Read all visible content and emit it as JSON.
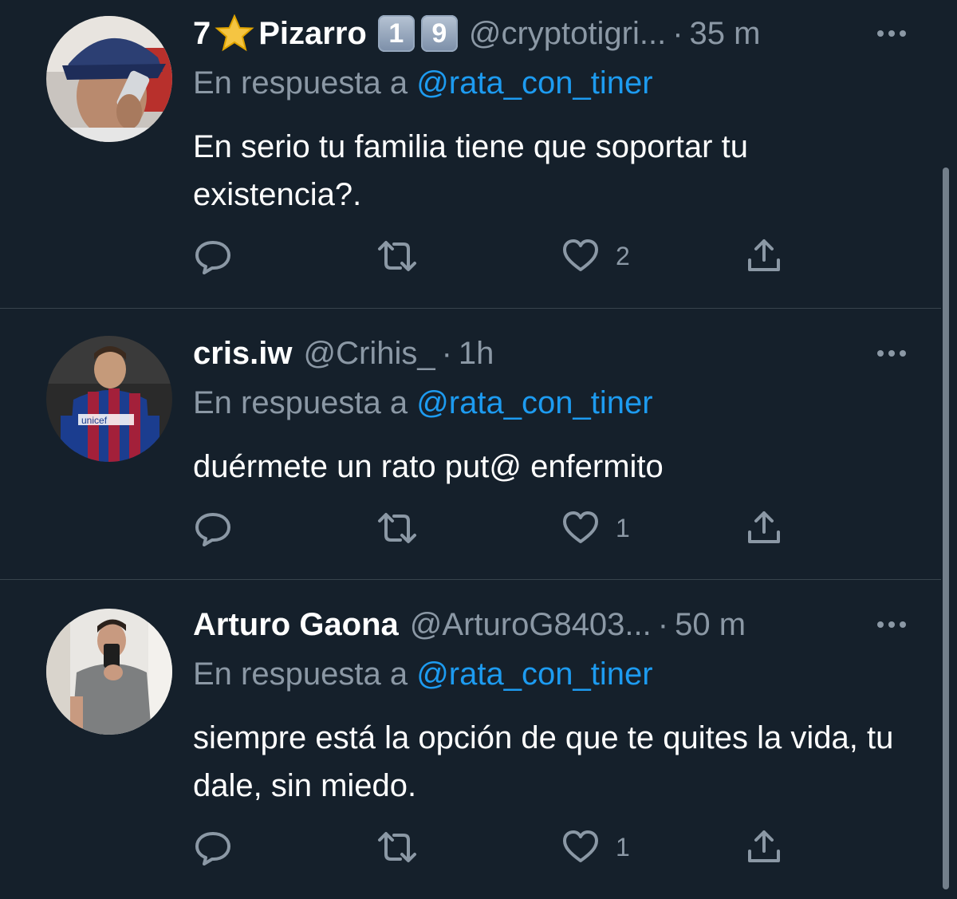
{
  "colors": {
    "background": "#15202b",
    "muted": "#8b98a5",
    "link": "#1d9bf0",
    "divider": "#38444d"
  },
  "tweets": [
    {
      "name_prefix": "7",
      "name_icon": "star-emoji-icon",
      "name": "Pizarro",
      "badges": [
        "1",
        "9"
      ],
      "handle": "@cryptotigri...",
      "dot": "·",
      "time": "35 m",
      "reply_prefix": "En respuesta a",
      "reply_mention": "@rata_con_tiner",
      "text": "En serio tu familia tiene que soportar tu existencia?.",
      "likes": "2",
      "avatar": "avatar-cap-phone"
    },
    {
      "name": "cris.iw",
      "handle": "@Crihis_",
      "dot": "·",
      "time": "1h",
      "reply_prefix": "En respuesta a",
      "reply_mention": "@rata_con_tiner",
      "text": "duérmete un rato put@ enfermito",
      "likes": "1",
      "avatar": "avatar-soccer-jersey"
    },
    {
      "name": "Arturo Gaona",
      "handle": "@ArturoG8403...",
      "dot": "·",
      "time": "50 m",
      "reply_prefix": "En respuesta a",
      "reply_mention": "@rata_con_tiner",
      "text": "siempre está la opción de que te quites la vida, tu dale, sin miedo.",
      "likes": "1",
      "avatar": "avatar-mirror-selfie"
    }
  ]
}
